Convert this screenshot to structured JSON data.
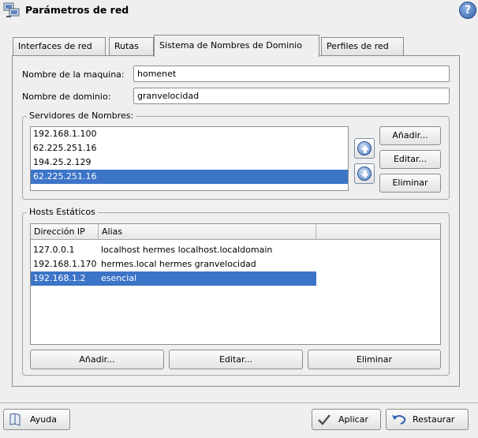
{
  "window": {
    "title": "Parámetros de red",
    "help_label": "?"
  },
  "tabs": [
    {
      "label": "Interfaces de red",
      "active": false
    },
    {
      "label": "Rutas",
      "active": false
    },
    {
      "label": "Sistema de Nombres de Dominio",
      "active": true
    },
    {
      "label": "Perfiles de red",
      "active": false
    }
  ],
  "form": {
    "machine_label": "Nombre de la maquina:",
    "machine_value": "homenet",
    "domain_label": "Nombre de dominio:",
    "domain_value": "granvelocidad"
  },
  "name_servers": {
    "title": "Servidores de Nombres:",
    "items": [
      "192.168.1.100",
      "62.225.251.16",
      "194.25.2.129",
      "62.225.251.16"
    ],
    "selected_index": 3,
    "add_label": "Añadir...",
    "edit_label": "Editar...",
    "remove_label": "Eliminar"
  },
  "static_hosts": {
    "title": "Hosts Estáticos",
    "columns": [
      "Dirección IP",
      "Alias"
    ],
    "rows": [
      {
        "ip": "127.0.0.1",
        "alias": "localhost hermes localhost.localdomain"
      },
      {
        "ip": "192.168.1.170",
        "alias": "hermes.local hermes granvelocidad"
      },
      {
        "ip": "192.168.1.2",
        "alias": "esencial"
      }
    ],
    "selected_index": 2,
    "add_label": "Añadir...",
    "edit_label": "Editar...",
    "remove_label": "Eliminar"
  },
  "footer": {
    "help_label": "Ayuda",
    "apply_label": "Aplicar",
    "restore_label": "Restaurar"
  },
  "colors": {
    "selection": "#3c74c8",
    "background": "#efefef"
  }
}
